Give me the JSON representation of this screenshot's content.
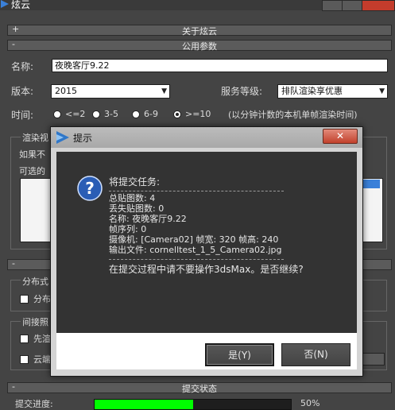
{
  "app": {
    "title": "炫云"
  },
  "rollouts": {
    "about": {
      "sign": "+",
      "title": "关于炫云"
    },
    "common": {
      "sign": "-",
      "title": "公用参数"
    },
    "submit": {
      "sign": "-",
      "title": "提交状态"
    }
  },
  "form": {
    "name_label": "名称:",
    "name_value": "夜晚客厅9.22",
    "version_label": "版本:",
    "version_value": "2015",
    "service_label": "服务等级:",
    "service_value": "排队渲染享优惠",
    "time_label": "时间:",
    "time_options": [
      "<=2",
      "3-5",
      "6-9",
      ">=10"
    ],
    "time_selected": ">=10",
    "time_note": "(以分钟计数的本机单帧渲染时间)"
  },
  "background_fragments": {
    "render_group": "渲染视",
    "if_text": "如果不",
    "optional_text": "可选的",
    "distributed_group": "分布式",
    "distributed_check": "分布",
    "indirect_group": "间接照",
    "first_check": "先渲",
    "cloud_check": "云端"
  },
  "progress": {
    "label": "提交进度:",
    "percent_text": "50%",
    "value": 0.5,
    "bar_color": "#00ff00"
  },
  "dialog": {
    "title": "提示",
    "close_symbol": "✕",
    "icon": "question-icon",
    "lines": [
      "将提交任务:",
      "总贴图数: 4",
      "丢失贴图数: 0",
      "名称: 夜晚客厅9.22",
      "帧序列: 0",
      "摄像机: [Camera02] 帧宽: 320 帧高: 240",
      "输出文件: cornelltest_1_5_Camera02.jpg",
      "在提交过程中请不要操作3dsMax。是否继续?"
    ],
    "yes_label": "是(Y)",
    "no_label": "否(N)"
  },
  "colors": {
    "accent_blue": "#3a80d9",
    "close_red": "#c43c2c",
    "progress_green": "#00ff00"
  }
}
